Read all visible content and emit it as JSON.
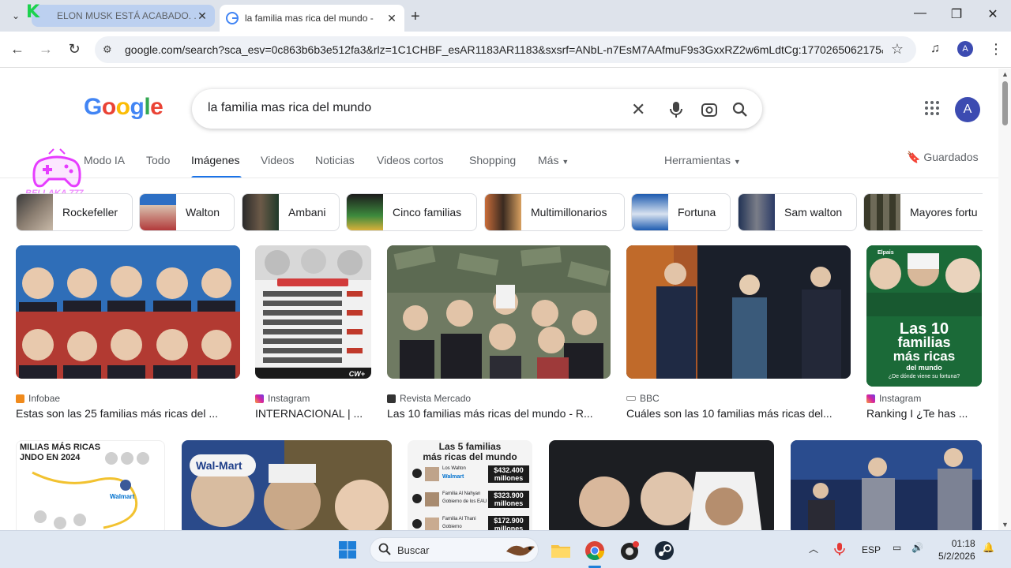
{
  "browser": {
    "tabs": [
      {
        "title": "ELON MUSK ESTÁ ACABADO. ..."
      },
      {
        "title": "la familia mas rica del mundo - "
      }
    ],
    "new_tab": "+",
    "url": "google.com/search?sca_esv=0c863b6b3e512fa3&rlz=1C1CHBF_esAR1183AR1183&sxsrf=ANbL-n7EsM7AAfmuF9s3GxxRZ2w6mLdtCg:1770265062175&...",
    "profile_initial": "A"
  },
  "overlay": {
    "k_logo": "K",
    "channel": "BELLAKA 777"
  },
  "google": {
    "query": "la familia mas rica del mundo",
    "avatar": "A",
    "tabs": [
      "Modo IA",
      "Todo",
      "Imágenes",
      "Videos",
      "Noticias",
      "Videos cortos",
      "Shopping",
      "Más"
    ],
    "tools": "Herramientas",
    "saved": "Guardados",
    "chips": [
      "Rockefeller",
      "Walton",
      "Ambani",
      "Cinco familias",
      "Multimillonarios",
      "Fortuna",
      "Sam walton",
      "Mayores fortu"
    ],
    "results": [
      {
        "source": "Infobae",
        "title": "Estas son las 25 familias más ricas del ..."
      },
      {
        "source": "Instagram",
        "title": "INTERNACIONAL | ..."
      },
      {
        "source": "Revista Mercado",
        "title": "Las 10 familias más ricas del mundo - R..."
      },
      {
        "source": "BBC",
        "title": "Cuáles son las 10 familias más ricas del..."
      },
      {
        "source": "Instagram",
        "title": "Ranking I ¿Te has ..."
      }
    ],
    "image_text": {
      "las10": "Las 10",
      "familias": "familias",
      "mas_ricas": "más ricas",
      "del_mundo": "del mundo",
      "donde": "¿De dónde viene su fortuna?",
      "elpais": "Elpais",
      "milias": "MILIAS MÁS RICAS",
      "jndo": "JNDO EN 2024",
      "cinco_title1": "Las 5 familias",
      "cinco_title2": "más ricas del mundo",
      "walton_label": "Los Walton",
      "walmart": "Walmart",
      "v1": "$432.400",
      "v1b": "millones",
      "nahyan": "Familia Al Nahyan",
      "nahyan2": "Gobierno de los EAU",
      "v2": "$323.900",
      "v2b": "millones",
      "althani": "Familia Al Thani",
      "althani2": "Gobierno",
      "v3": "$172.900",
      "v3b": "millones",
      "walmart_cap": "Wal-Mart",
      "cw": "CW+"
    }
  },
  "taskbar": {
    "search": "Buscar",
    "lang": "ESP",
    "time": "01:18",
    "date": "5/2/2026"
  }
}
